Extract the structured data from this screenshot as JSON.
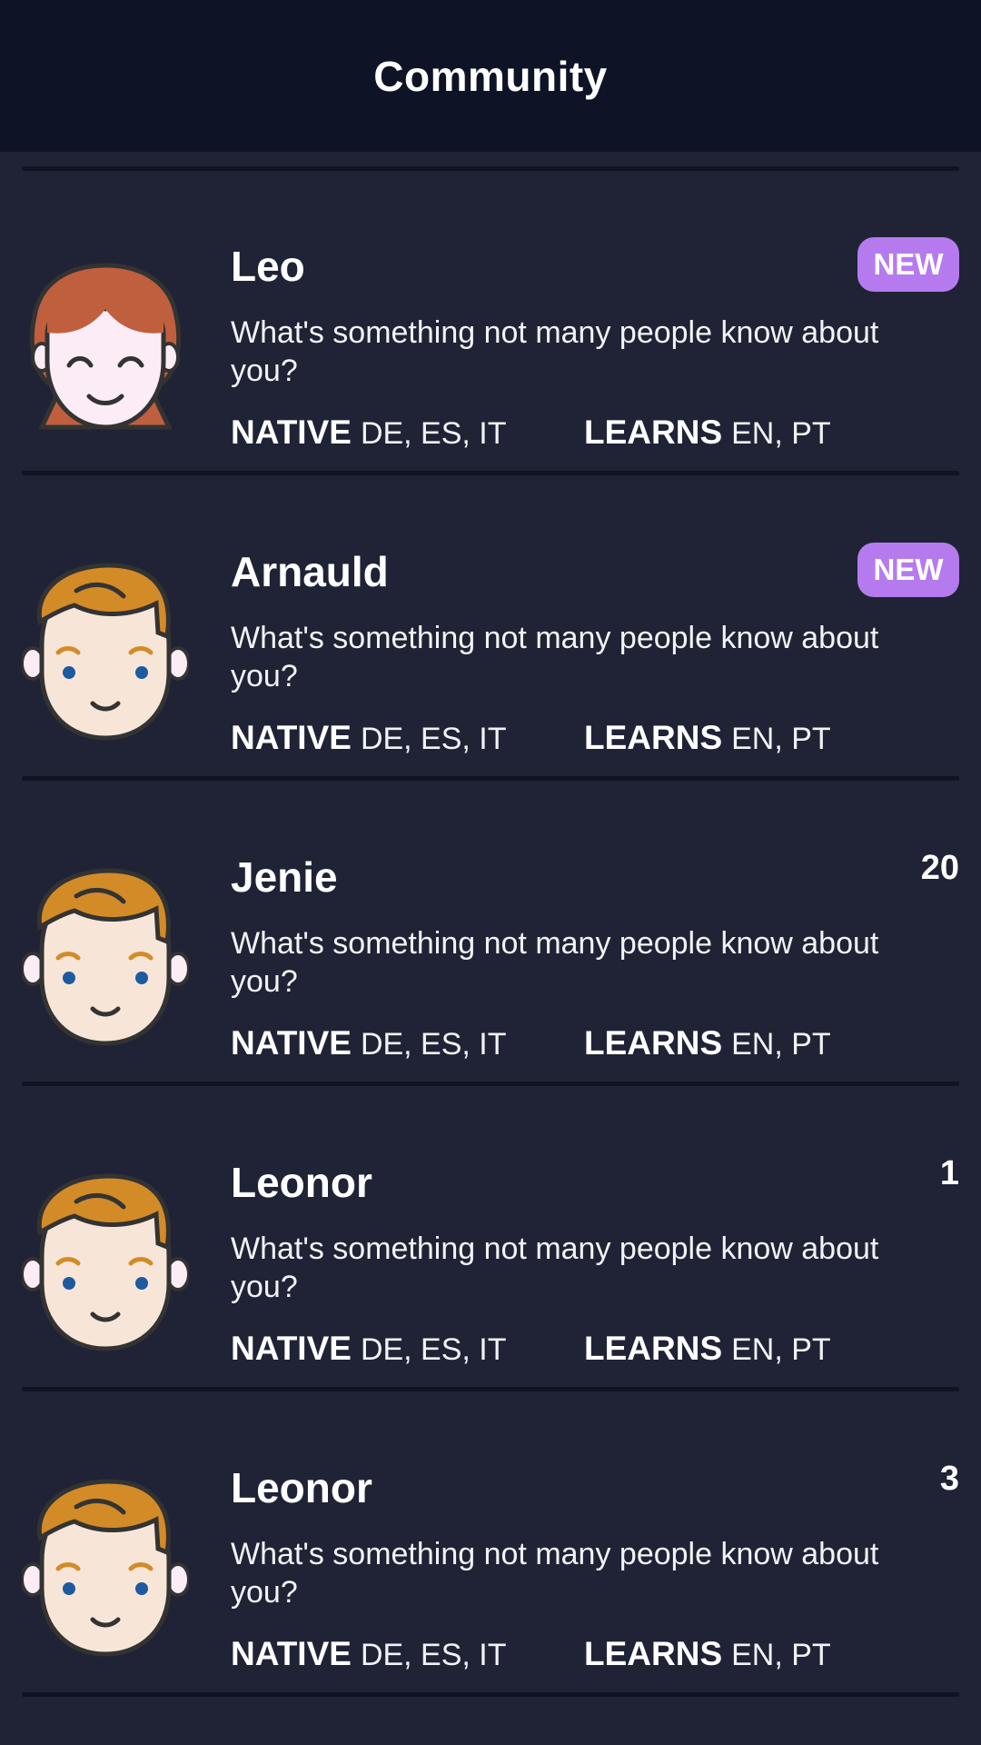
{
  "header": {
    "title": "Community"
  },
  "labels": {
    "native": "NATIVE",
    "learns": "LEARNS",
    "new_badge": "NEW"
  },
  "colors": {
    "header_bg": "#0e1426",
    "page_bg": "#1f2335",
    "badge": "#b57bee",
    "divider": "#0f1322"
  },
  "users": [
    {
      "name": "Leo",
      "message": "What's something not many people know about you?",
      "native": "DE, ES, IT",
      "learns": "EN, PT",
      "badge": "NEW",
      "count": "",
      "avatar": "female-avatar"
    },
    {
      "name": "Arnauld",
      "message": "What's something not many people know about you?",
      "native": "DE, ES, IT",
      "learns": "EN, PT",
      "badge": "NEW",
      "count": "",
      "avatar": "male-avatar"
    },
    {
      "name": "Jenie",
      "message": "What's something not many people know about you?",
      "native": "DE, ES, IT",
      "learns": "EN, PT",
      "badge": "",
      "count": "20",
      "avatar": "male-avatar"
    },
    {
      "name": "Leonor",
      "message": "What's something not many people know about you?",
      "native": "DE, ES, IT",
      "learns": "EN, PT",
      "badge": "",
      "count": "1",
      "avatar": "male-avatar"
    },
    {
      "name": "Leonor",
      "message": "What's something not many people know about you?",
      "native": "DE, ES, IT",
      "learns": "EN, PT",
      "badge": "",
      "count": "3",
      "avatar": "male-avatar"
    }
  ]
}
